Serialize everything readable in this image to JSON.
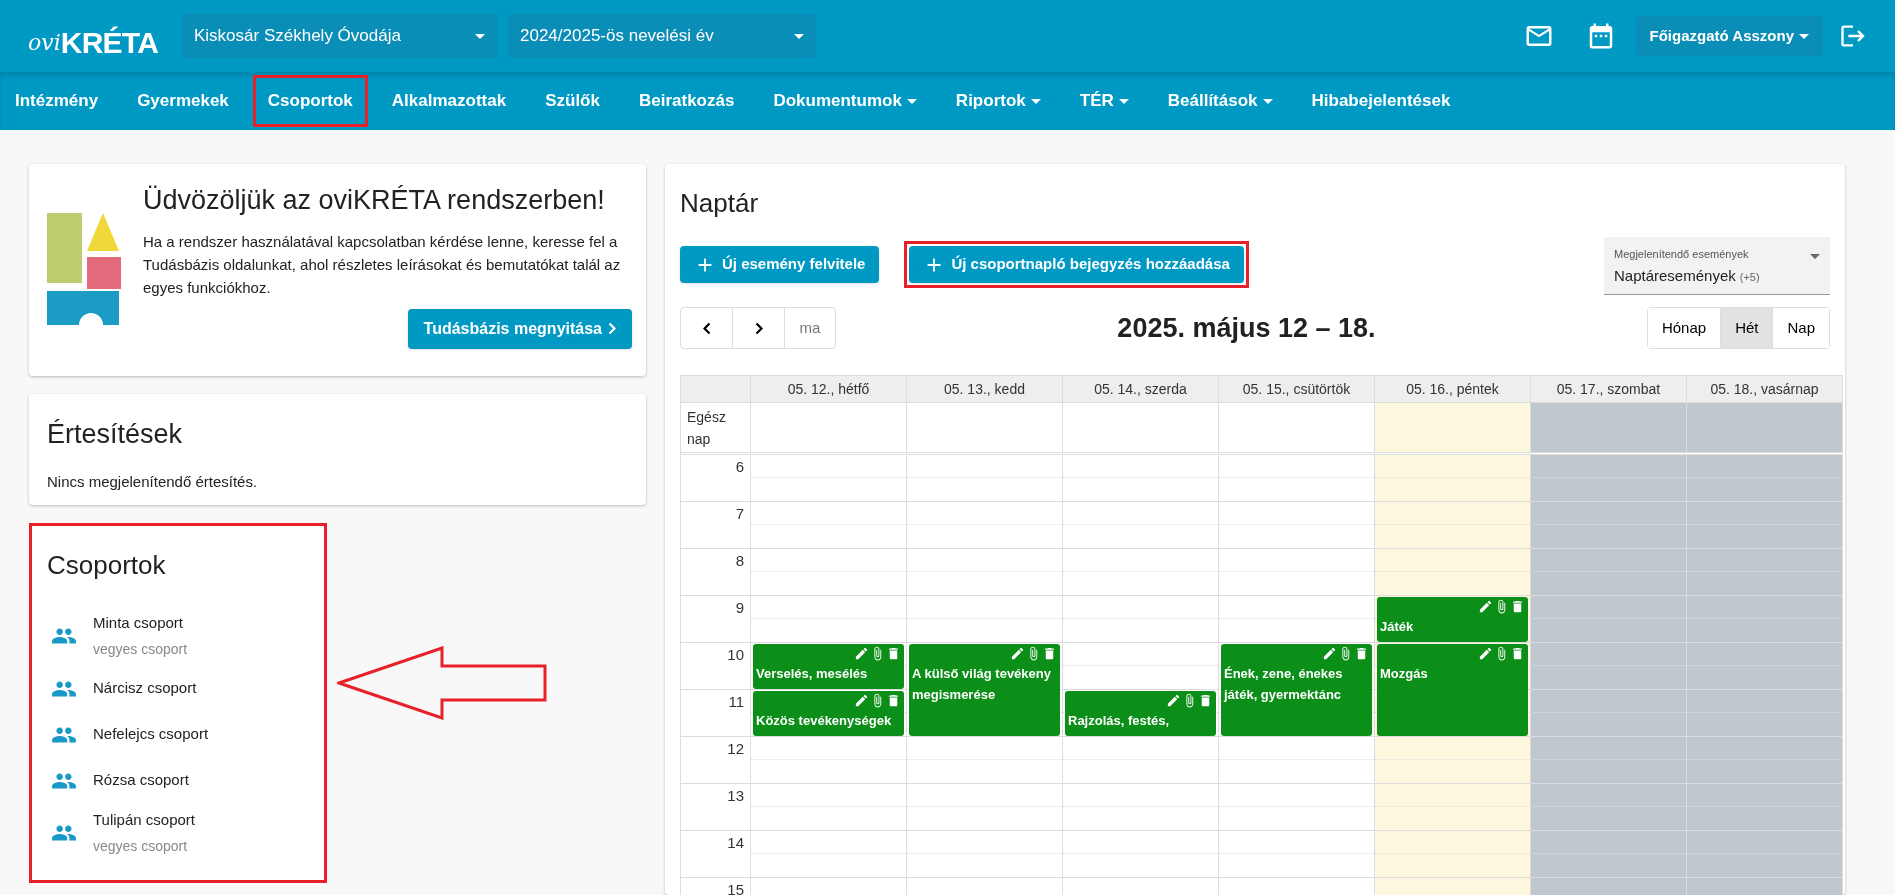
{
  "header": {
    "logo": {
      "prefix": "ovi",
      "name": "KRÉTA"
    },
    "institution": "Kiskosár Székhely Óvodája",
    "year": "2024/2025-ös nevelési év",
    "user": "Főigazgató Asszony"
  },
  "nav": [
    {
      "label": "Intézmény",
      "dropdown": false,
      "highlighted": false
    },
    {
      "label": "Gyermekek",
      "dropdown": false,
      "highlighted": false
    },
    {
      "label": "Csoportok",
      "dropdown": false,
      "highlighted": true
    },
    {
      "label": "Alkalmazottak",
      "dropdown": false,
      "highlighted": false
    },
    {
      "label": "Szülők",
      "dropdown": false,
      "highlighted": false
    },
    {
      "label": "Beiratkozás",
      "dropdown": false,
      "highlighted": false
    },
    {
      "label": "Dokumentumok",
      "dropdown": true,
      "highlighted": false
    },
    {
      "label": "Riportok",
      "dropdown": true,
      "highlighted": false
    },
    {
      "label": "TÉR",
      "dropdown": true,
      "highlighted": false
    },
    {
      "label": "Beállítások",
      "dropdown": true,
      "highlighted": false
    },
    {
      "label": "Hibabejelentések",
      "dropdown": false,
      "highlighted": false
    }
  ],
  "welcome": {
    "title": "Üdvözöljük az oviKRÉTA rendszerben!",
    "text": "Ha a rendszer használatával kapcsolatban kérdése lenne, keresse fel a Tudásbázis oldalunkat, ahol részletes leírásokat és bemutatókat talál az egyes funkciókhoz.",
    "button": "Tudásbázis megnyitása"
  },
  "notifications": {
    "title": "Értesítések",
    "empty_text": "Nincs megjelenítendő értesítés."
  },
  "groups": {
    "title": "Csoportok",
    "highlighted": true,
    "callout_arrow": true,
    "items": [
      {
        "name": "Minta csoport",
        "subtitle": "vegyes csoport"
      },
      {
        "name": "Nárcisz csoport"
      },
      {
        "name": "Nefelejcs csoport"
      },
      {
        "name": "Rózsa csoport"
      },
      {
        "name": "Tulipán csoport",
        "subtitle": "vegyes csoport"
      }
    ]
  },
  "calendar": {
    "title": "Naptár",
    "buttons": [
      {
        "label": "Új esemény felvitele",
        "highlighted": false
      },
      {
        "label": "Új csoportnapló bejegyzés hozzáadása",
        "highlighted": true
      }
    ],
    "filter": {
      "label": "Megjelenítendő események",
      "value": "Naptáresemények",
      "count": "(+5)"
    },
    "today": "ma",
    "range": "2025. május 12 – 18.",
    "views": [
      {
        "label": "Hónap",
        "selected": false
      },
      {
        "label": "Hét",
        "selected": true
      },
      {
        "label": "Nap",
        "selected": false
      }
    ],
    "all_day_label": "Egész nap",
    "hours": [
      "6",
      "7",
      "8",
      "9",
      "10",
      "11",
      "12",
      "13",
      "14",
      "15"
    ],
    "days": [
      {
        "label": "05. 12., hétfő",
        "kind": "weekday",
        "slots": [
          {
            "kind": "free"
          },
          {
            "kind": "free"
          },
          {
            "kind": "free"
          },
          {
            "kind": "free"
          },
          {
            "kind": "short",
            "title": "Verselés, mesélés"
          },
          {
            "kind": "short",
            "title": "Közös tevékenységek"
          }
        ]
      },
      {
        "label": "05. 13., kedd",
        "kind": "weekday",
        "slots": [
          {
            "kind": "free"
          },
          {
            "kind": "free"
          },
          {
            "kind": "free"
          },
          {
            "kind": "free"
          },
          {
            "kind": "long",
            "title": "A külső világ tevékeny megismerése"
          }
        ]
      },
      {
        "label": "05. 14., szerda",
        "kind": "weekday",
        "slots": [
          {
            "kind": "free"
          },
          {
            "kind": "free"
          },
          {
            "kind": "free"
          },
          {
            "kind": "free"
          },
          {
            "kind": "free"
          },
          {
            "kind": "short",
            "title": "Rajzolás, festés,"
          }
        ]
      },
      {
        "label": "05. 15., csütörtök",
        "kind": "weekday",
        "slots": [
          {
            "kind": "free"
          },
          {
            "kind": "free"
          },
          {
            "kind": "free"
          },
          {
            "kind": "free"
          },
          {
            "kind": "long",
            "title": "Ének, zene, énekes játék, gyermektánc"
          }
        ]
      },
      {
        "label": "05. 16., péntek",
        "kind": "today",
        "slots": [
          {
            "kind": "free"
          },
          {
            "kind": "free"
          },
          {
            "kind": "free"
          },
          {
            "kind": "short",
            "title": "Játék"
          },
          {
            "kind": "long",
            "title": "Mozgás"
          }
        ]
      },
      {
        "label": "05. 17., szombat",
        "kind": "weekend"
      },
      {
        "label": "05. 18., vasárnap",
        "kind": "weekend"
      }
    ]
  }
}
